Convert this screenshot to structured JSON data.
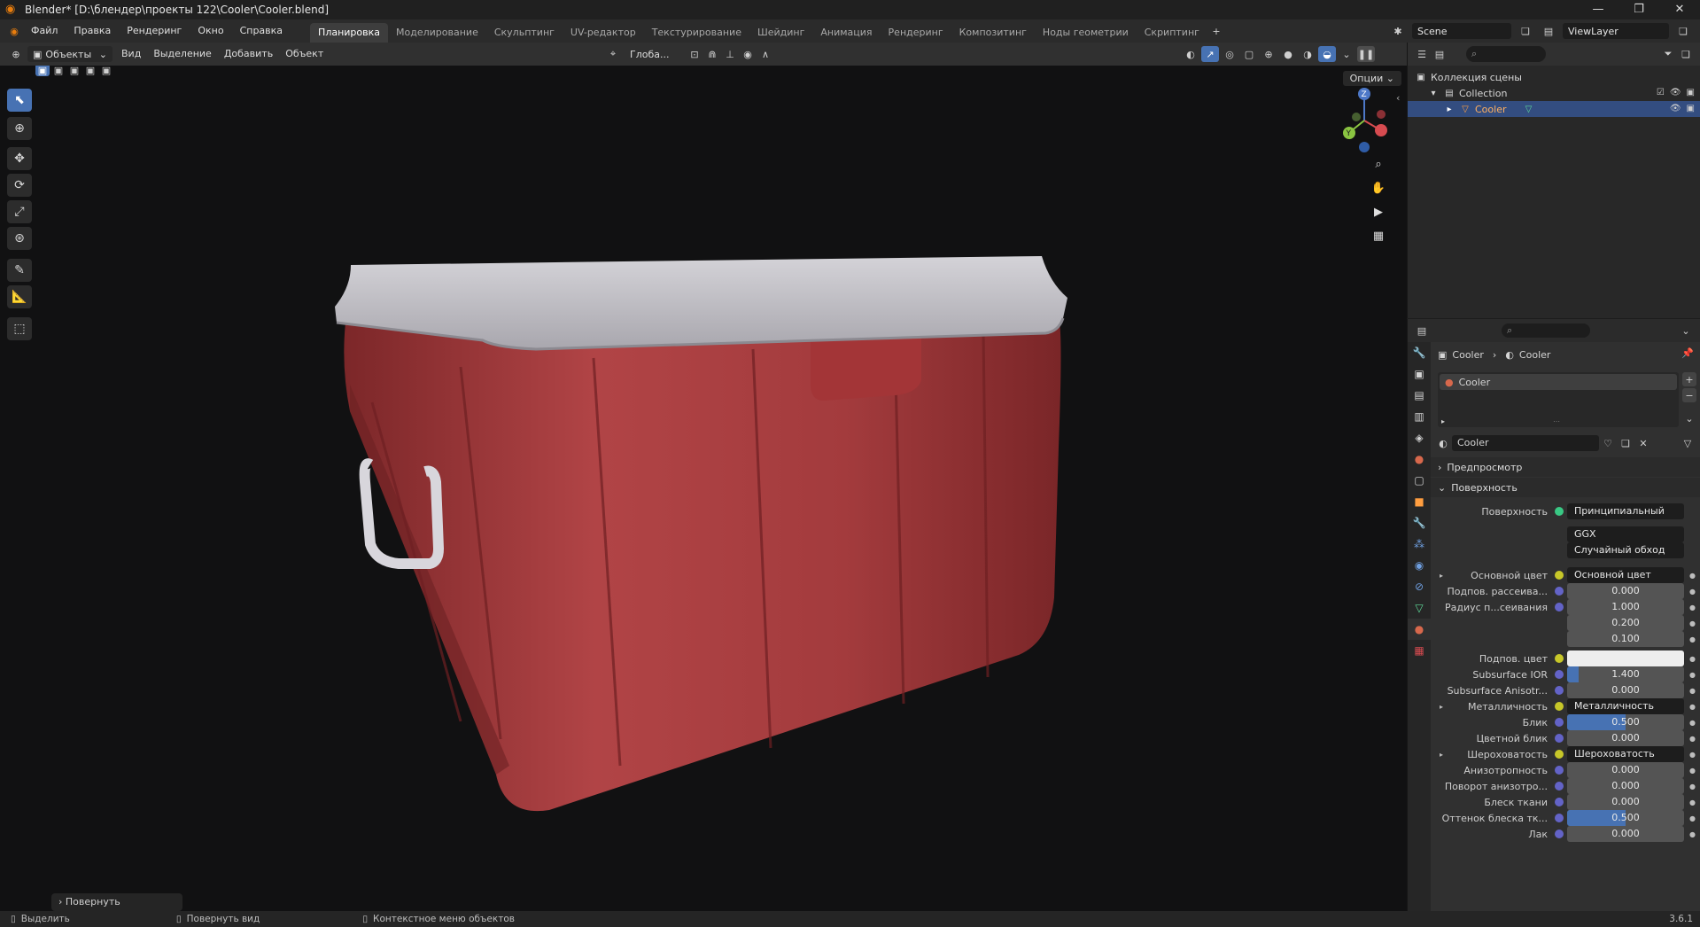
{
  "window": {
    "title": "Blender* [D:\\блендер\\проекты 122\\Cooler\\Cooler.blend]",
    "buttons": [
      "—",
      "❐",
      "✕"
    ]
  },
  "menu": [
    "Файл",
    "Правка",
    "Рендеринг",
    "Окно",
    "Справка"
  ],
  "workspaces": [
    "Планировка",
    "Моделирование",
    "Скульптинг",
    "UV-редактор",
    "Текстурирование",
    "Шейдинг",
    "Анимация",
    "Рендеринг",
    "Композитинг",
    "Ноды геометрии",
    "Скриптинг"
  ],
  "active_workspace": "Планировка",
  "scene": {
    "name": "Scene",
    "view_layer": "ViewLayer"
  },
  "viewport_header": {
    "mode": "Объекты",
    "menus": [
      "Вид",
      "Выделение",
      "Добавить",
      "Объект"
    ],
    "orientation": "Глоба...",
    "options": "Опции"
  },
  "last_operator": "Повернуть",
  "outliner": {
    "root": "Коллекция сцены",
    "collection": "Collection",
    "object": "Cooler"
  },
  "properties": {
    "breadcrumb": [
      "Cooler",
      "Cooler"
    ],
    "material_slot": "Cooler",
    "material_name": "Cooler",
    "panels": {
      "preview": "Предпросмотр",
      "surface": "Поверхность"
    },
    "surface_shader_label": "Поверхность",
    "surface_shader": "Принципиальный BSDF",
    "distribution": "GGX",
    "subsurface_method": "Случайный обход",
    "rows": [
      {
        "label": "Основной цвет",
        "value": "Основной цвет",
        "kind": "link"
      },
      {
        "label": "Подпов. рассеива...",
        "value": "0.000",
        "fill": 0
      },
      {
        "label": "Радиус п...сеивания",
        "value": "1.000",
        "fill": 0
      },
      {
        "label": "",
        "value": "0.200",
        "fill": 0
      },
      {
        "label": "",
        "value": "0.100",
        "fill": 0
      },
      {
        "label": "Подпов. цвет",
        "value": "",
        "kind": "color"
      },
      {
        "label": "Subsurface IOR",
        "value": "1.400",
        "fill": 0.1
      },
      {
        "label": "Subsurface Anisotr...",
        "value": "0.000",
        "fill": 0
      },
      {
        "label": "Металличность",
        "value": "Металличность",
        "kind": "link"
      },
      {
        "label": "Блик",
        "value": "0.500",
        "fill": 0.5
      },
      {
        "label": "Цветной блик",
        "value": "0.000",
        "fill": 0
      },
      {
        "label": "Шероховатость",
        "value": "Шероховатость",
        "kind": "link"
      },
      {
        "label": "Анизотропность",
        "value": "0.000",
        "fill": 0
      },
      {
        "label": "Поворот анизотро...",
        "value": "0.000",
        "fill": 0
      },
      {
        "label": "Блеск ткани",
        "value": "0.000",
        "fill": 0
      },
      {
        "label": "Оттенок блеска тк...",
        "value": "0.500",
        "fill": 0.5
      },
      {
        "label": "Лак",
        "value": "0.000",
        "fill": 0
      }
    ]
  },
  "statusbar": {
    "select": "Выделить",
    "rotate": "Повернуть вид",
    "context": "Контекстное меню объектов",
    "version": "3.6.1"
  }
}
